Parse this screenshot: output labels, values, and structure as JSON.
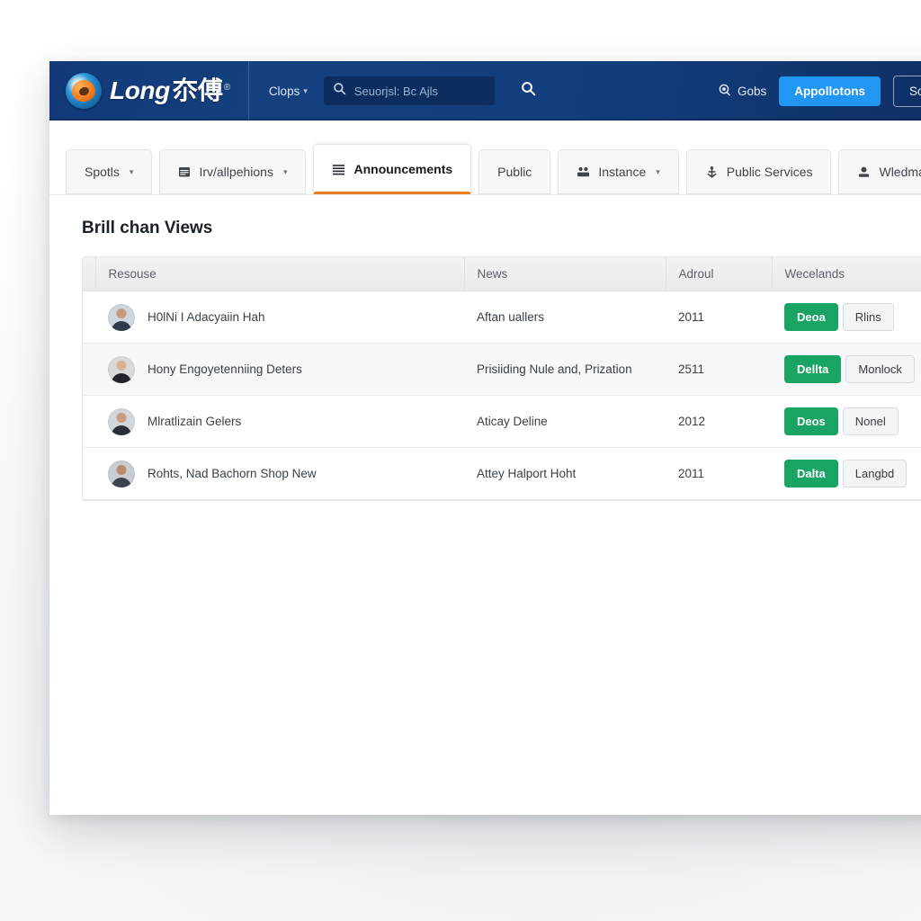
{
  "topbar": {
    "brand": {
      "name": "Long",
      "cjk": "夵傅",
      "registered": "®",
      "icon": "peach-logo-icon"
    },
    "nav_link": {
      "label": "Clops",
      "caret": "▾"
    },
    "search": {
      "value": "",
      "placeholder": "Seuorjsl: Bc Ajls",
      "icon": "search-icon",
      "submit_icon": "search-submit-icon"
    },
    "right": {
      "gobs": {
        "label": "Gobs",
        "icon": "globe-icon"
      },
      "primary_button": "Appollotons",
      "ghost_button": "Someers"
    },
    "colors": {
      "bar_start": "#123a78",
      "bar_end": "#0f2f63",
      "primary": "#2196f3"
    }
  },
  "tabs": [
    {
      "label": "Spotls",
      "icon": "",
      "caret": "▾",
      "active": false
    },
    {
      "label": "Irv/allpehions",
      "icon": "calendar-icon",
      "caret": "▾",
      "active": false
    },
    {
      "label": "Announcements",
      "icon": "list-icon",
      "caret": "",
      "active": true
    },
    {
      "label": "Public",
      "icon": "",
      "caret": "",
      "active": false
    },
    {
      "label": "Instance",
      "icon": "people-icon",
      "caret": "▾",
      "active": false
    },
    {
      "label": "Public Services",
      "icon": "anchor-icon",
      "caret": "",
      "active": false
    },
    {
      "label": "Wledmare Au",
      "icon": "user-icon",
      "caret": "",
      "active": false
    }
  ],
  "tab_accent_color": "#f07d1a",
  "main": {
    "title": "Brill chan Views",
    "table": {
      "columns": [
        "Resouse",
        "News",
        "Adroul",
        "Wecelands"
      ],
      "rows": [
        {
          "avatar": "avatar-person-1",
          "resource": "H0lNi I Adacyaiin Hah",
          "news": "Aftan uallers",
          "adroul": "2011",
          "primary_action": "Deoa",
          "secondary_action": "Rlins"
        },
        {
          "avatar": "avatar-person-2",
          "resource": "Hony Engoyetenniing Deters",
          "news": "Prisiiding Nule and, Prization",
          "adroul": "2511",
          "primary_action": "Dellta",
          "secondary_action": "Monlock"
        },
        {
          "avatar": "avatar-person-3",
          "resource": "Mlratlizain Gelers",
          "news": "Aticay Deline",
          "adroul": "2012",
          "primary_action": "Deos",
          "secondary_action": "Nonel"
        },
        {
          "avatar": "avatar-person-4",
          "resource": "Rohts, Nad Bachorn Shop New",
          "news": "Attey Halport Hoht",
          "adroul": "2011",
          "primary_action": "Dalta",
          "secondary_action": "Langbd"
        }
      ],
      "colors": {
        "primary_action": "#19a463",
        "header_bg": "#eceef0"
      }
    }
  }
}
